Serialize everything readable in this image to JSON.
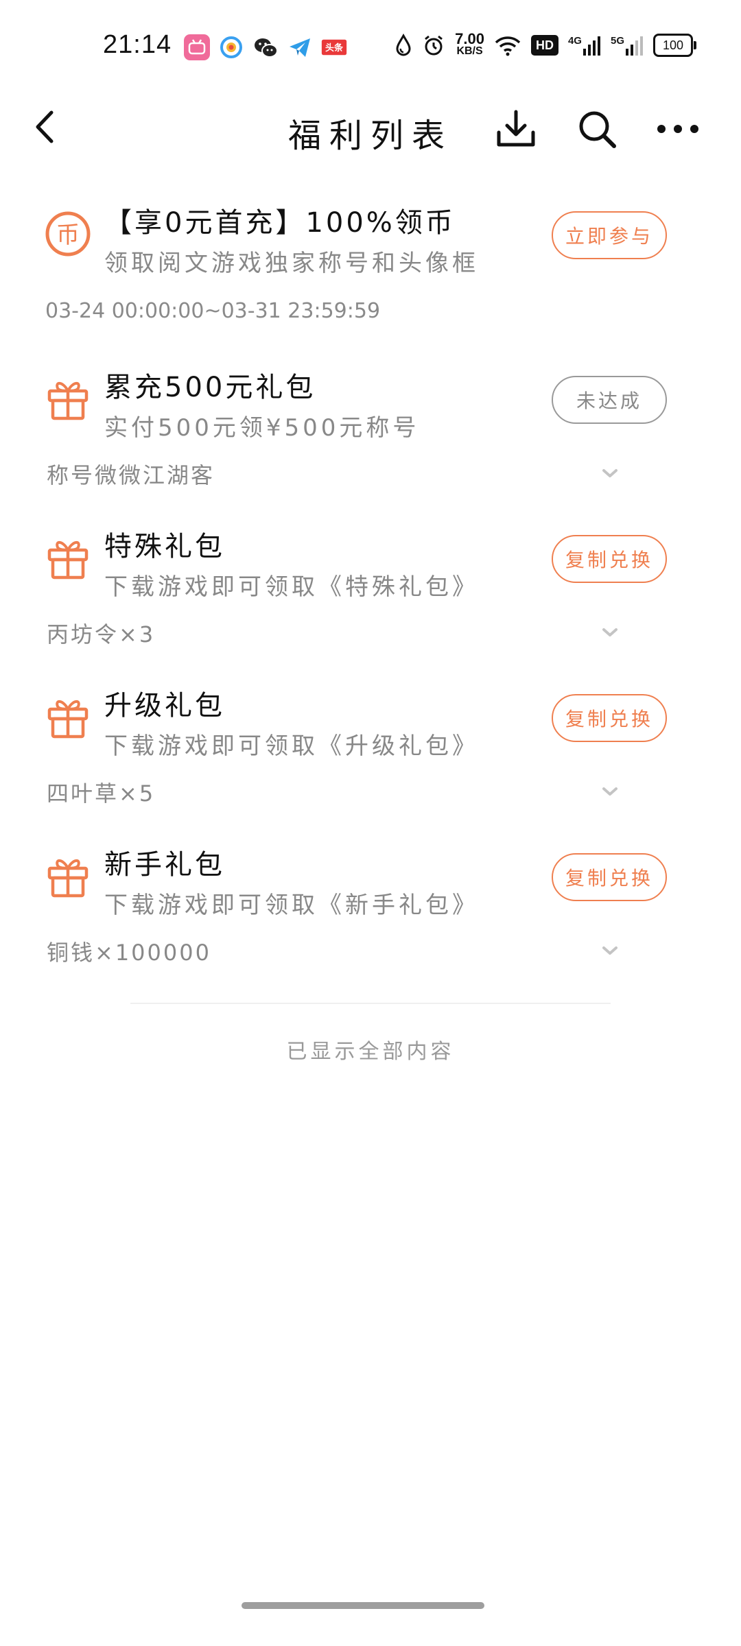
{
  "status_bar": {
    "time": "21:14",
    "net_speed_value": "7.00",
    "net_speed_unit": "KB/S",
    "hd_label": "HD",
    "signal_4g": "4G",
    "signal_5g": "5G",
    "battery": "100",
    "notification_icons": [
      "bilibili-icon",
      "qq-browser-icon",
      "wechat-icon",
      "telegram-icon",
      "toutiao-icon"
    ],
    "toutiao_label": "头条"
  },
  "nav": {
    "title": "福利列表"
  },
  "colors": {
    "accent": "#ef7f4f",
    "muted": "#888888"
  },
  "items": [
    {
      "icon": "coin-icon",
      "title": "【享0元首充】100%领币",
      "desc": "领取阅文游戏独家称号和头像框",
      "time": "03-24 00:00:00~03-31 23:59:59",
      "button": "立即参与",
      "button_style": "accent"
    },
    {
      "icon": "gift-icon",
      "title": "累充500元礼包",
      "desc": "实付500元领¥500元称号",
      "extra": "称号微微江湖客",
      "button": "未达成",
      "button_style": "gray"
    },
    {
      "icon": "gift-icon",
      "title": "特殊礼包",
      "desc": "下载游戏即可领取《特殊礼包》",
      "extra": "丙坊令×3",
      "button": "复制兑换",
      "button_style": "accent"
    },
    {
      "icon": "gift-icon",
      "title": "升级礼包",
      "desc": "下载游戏即可领取《升级礼包》",
      "extra": "四叶草×5",
      "button": "复制兑换",
      "button_style": "accent"
    },
    {
      "icon": "gift-icon",
      "title": "新手礼包",
      "desc": "下载游戏即可领取《新手礼包》",
      "extra": "铜钱×100000",
      "button": "复制兑换",
      "button_style": "accent"
    }
  ],
  "footer": {
    "end_text": "已显示全部内容"
  }
}
